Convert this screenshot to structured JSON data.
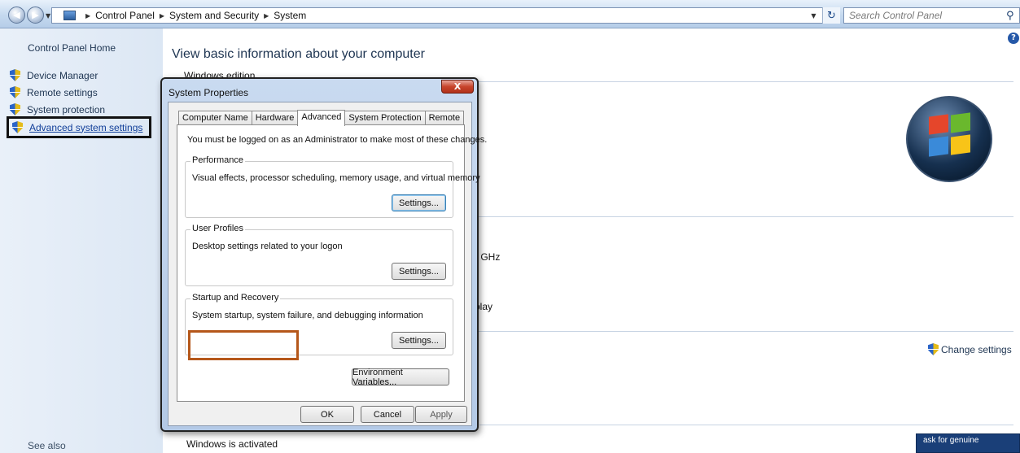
{
  "address_bar": {
    "crumbs": [
      "Control Panel",
      "System and Security",
      "System"
    ],
    "search_placeholder": "Search Control Panel"
  },
  "left_nav": {
    "home": "Control Panel Home",
    "items": [
      {
        "label": "Device Manager"
      },
      {
        "label": "Remote settings"
      },
      {
        "label": "System protection"
      },
      {
        "label": "Advanced system settings"
      }
    ],
    "see_also": "See also"
  },
  "main": {
    "title": "View basic information about your computer",
    "section_edition": "Windows edition",
    "partial_ghz": ") GHz",
    "partial_play": "play",
    "change_settings": "Change settings",
    "activated": "Windows is activated",
    "genuine_badge": "ask for genuine"
  },
  "dialog": {
    "title": "System Properties",
    "close_label": "X",
    "tabs": [
      {
        "label": "Computer Name",
        "active": false
      },
      {
        "label": "Hardware",
        "active": false
      },
      {
        "label": "Advanced",
        "active": true
      },
      {
        "label": "System Protection",
        "active": false
      },
      {
        "label": "Remote",
        "active": false
      }
    ],
    "admin_note": "You must be logged on as an Administrator to make most of these changes.",
    "groups": {
      "performance": {
        "legend": "Performance",
        "desc": "Visual effects, processor scheduling, memory usage, and virtual memory",
        "button": "Settings..."
      },
      "user_profiles": {
        "legend": "User Profiles",
        "desc": "Desktop settings related to your logon",
        "button": "Settings..."
      },
      "startup_recovery": {
        "legend": "Startup and Recovery",
        "desc": "System startup, system failure, and debugging information",
        "button": "Settings..."
      }
    },
    "env_button": "Environment Variables...",
    "ok": "OK",
    "cancel": "Cancel",
    "apply": "Apply"
  },
  "colors": {
    "highlight_box": "#b5571a",
    "nav_link": "#1e3552",
    "nav_background": "#dce7f4"
  }
}
